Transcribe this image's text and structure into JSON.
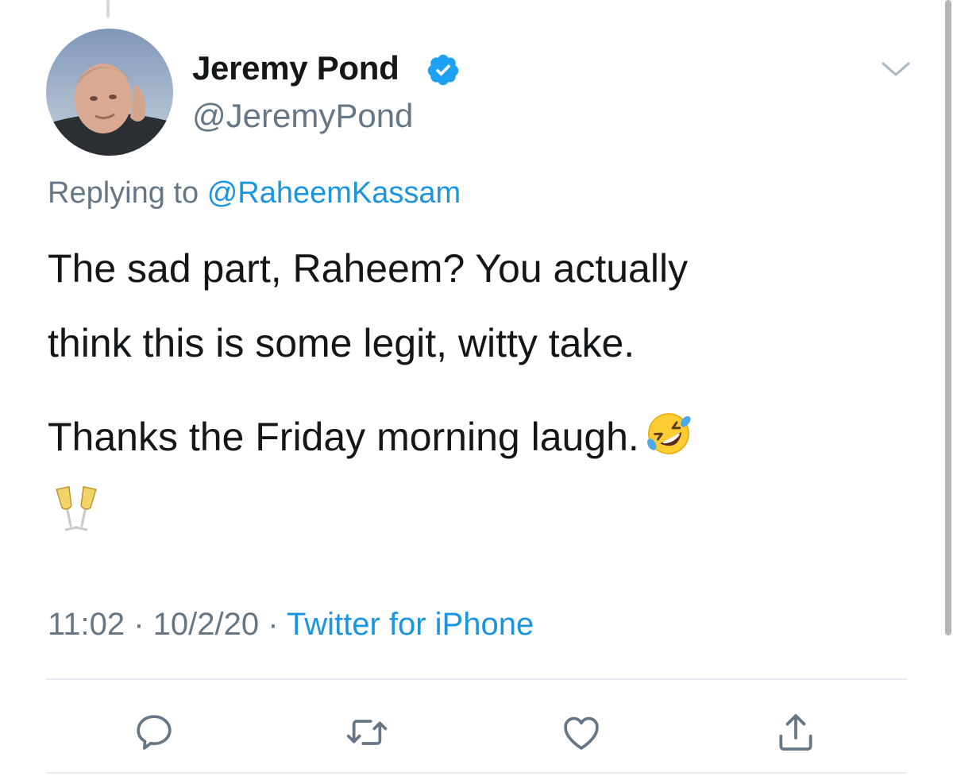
{
  "tweet": {
    "author": {
      "display_name": "Jeremy Pond",
      "handle": "@JeremyPond",
      "verified": true
    },
    "replying_to": {
      "prefix": "Replying to",
      "mention": "@RaheemKassam"
    },
    "text_lines": [
      "The sad part, Raheem? You actually",
      "think this is some legit, witty take.",
      "Thanks the Friday morning laugh."
    ],
    "timestamp": "11:02 · 10/2/20 · ",
    "source": "Twitter for iPhone"
  },
  "icons": {
    "verified": "verified-badge-icon",
    "more": "chevron-down-icon",
    "reply": "reply-icon",
    "retweet": "retweet-icon",
    "like": "heart-icon",
    "share": "share-icon",
    "emoji_1": "rolling-on-floor-laughing-emoji",
    "emoji_2": "clinking-glasses-emoji"
  },
  "colors": {
    "link": "#1b95e0",
    "secondary_text": "#657786",
    "primary_text": "#14171a",
    "verified": "#1da1f2"
  }
}
